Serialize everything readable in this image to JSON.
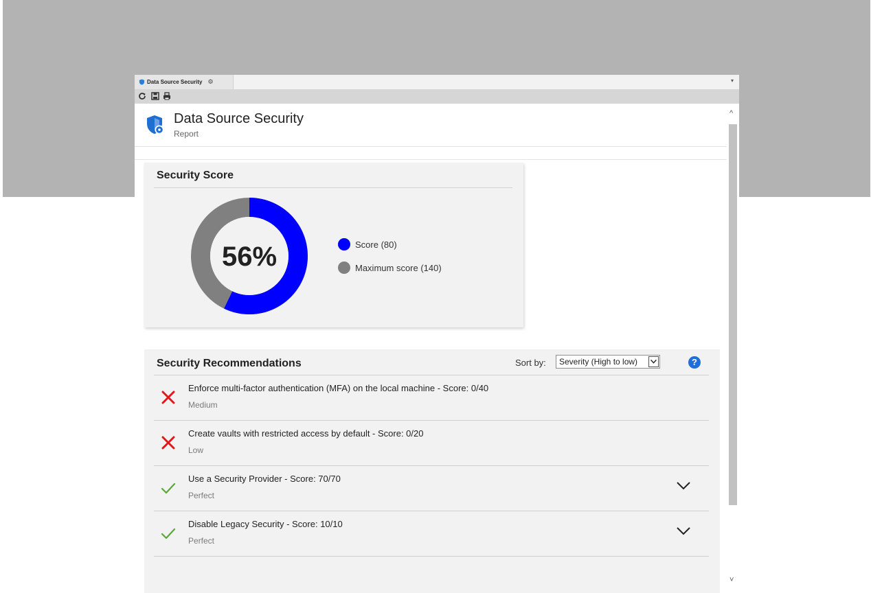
{
  "tab": {
    "label": "Data Source Security"
  },
  "header": {
    "title": "Data Source Security",
    "subtitle": "Report"
  },
  "score_card": {
    "title": "Security Score",
    "percent_label": "56%",
    "score": 80,
    "maximum": 140,
    "fraction": 0.56,
    "legend": [
      {
        "label": "Score (80)",
        "color": "#0000ff"
      },
      {
        "label": "Maximum score (140)",
        "color": "#808080"
      }
    ]
  },
  "recommendations": {
    "title": "Security Recommendations",
    "sort_label": "Sort by:",
    "sort_value": "Severity (High to low)",
    "help_symbol": "?",
    "items": [
      {
        "text": "Enforce multi-factor authentication (MFA) on the local machine - Score: 0/40",
        "severity": "Medium",
        "status": "fail",
        "icon": "x-icon",
        "expandable": false
      },
      {
        "text": "Create vaults with restricted access by default - Score: 0/20",
        "severity": "Low",
        "status": "fail",
        "icon": "x-icon",
        "expandable": false
      },
      {
        "text": "Use a Security Provider - Score: 70/70",
        "severity": "Perfect",
        "status": "pass",
        "icon": "check-icon",
        "expandable": true
      },
      {
        "text": "Disable Legacy Security - Score: 10/10",
        "severity": "Perfect",
        "status": "pass",
        "icon": "check-icon",
        "expandable": true
      }
    ]
  },
  "colors": {
    "fail": "#e3171b",
    "pass": "#59a832",
    "accent": "#0000ff",
    "muted": "#808080",
    "help": "#1e6fd9"
  }
}
